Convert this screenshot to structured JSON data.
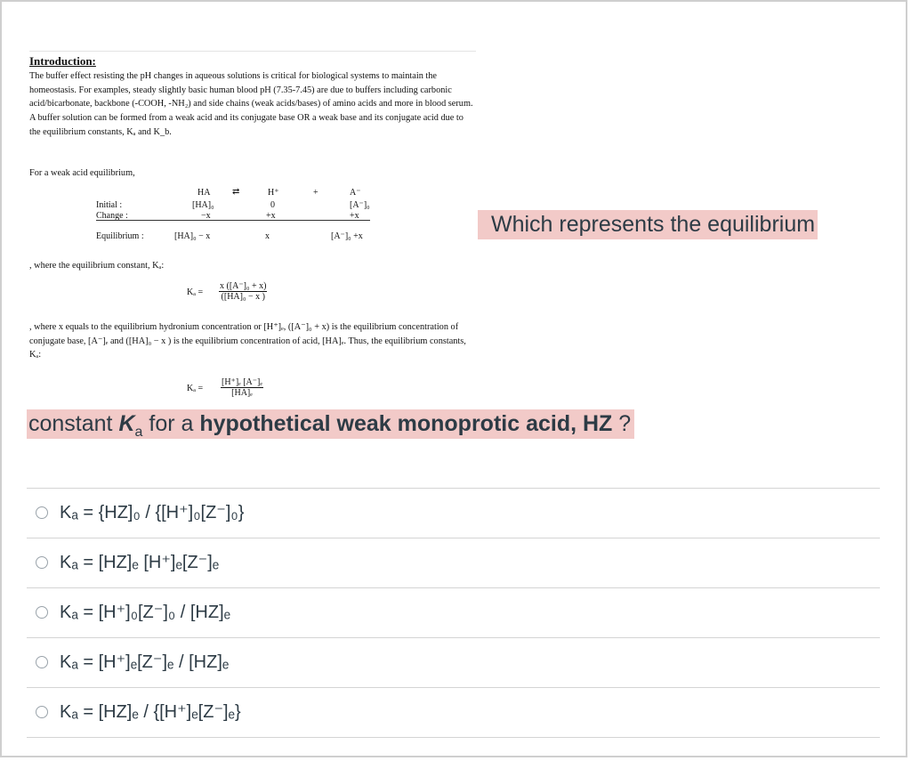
{
  "intro": {
    "title": "Introduction:",
    "paragraph": "The buffer effect resisting the pH changes in aqueous solutions is critical for biological systems to maintain the homeostasis. For examples, steady slightly basic human blood pH (7.35-7.45) are due to buffers including carbonic acid/bicarbonate, backbone (-COOH, -NH₂) and side chains (weak acids/bases) of amino acids and more in blood serum. A buffer solution can be formed from a weak acid and its conjugate base OR a weak base and its conjugate acid due to the equilibrium constants, Kₐ and K_b.",
    "weak_acid_line": "For a weak acid equilibrium,",
    "ice": {
      "species": [
        "HA",
        "⇄",
        "H⁺",
        "+",
        "A⁻"
      ],
      "initial_label": "Initial   :",
      "initial": [
        "[HA]₀",
        "0",
        "[A⁻]₀"
      ],
      "change_label": "Change :",
      "change": [
        "−x",
        "+x",
        "+x"
      ],
      "equilibrium_label": "Equilibrium :",
      "equilibrium": [
        "[HA]₀ − x",
        "x",
        "[A⁻]₀ +x"
      ]
    },
    "where_ka": ", where the equilibrium constant, Kₐ:",
    "ka_expr_1": {
      "lhs": "Kₐ  =",
      "num": "x ([A⁻]₀ + x)",
      "den": "([HA]₀ − x )"
    },
    "where_x": ", where x equals to the equilibrium hydronium concentration or [H⁺]ₑ, ([A⁻]₀ + x) is the equilibrium concentration of conjugate base, [A⁻]ₑ and ([HA]₀ − x ) is the equilibrium concentration of acid, [HA]ₑ. Thus, the equilibrium constants, Kₐ:",
    "ka_expr_2": {
      "lhs": "Kₐ  =",
      "num": "[H⁺]ₑ [A⁻]ₑ",
      "den": "[HA]ₑ"
    }
  },
  "question": {
    "part1": "Which represents the equilibrium",
    "part2_prefix": "constant ",
    "part2_k": "K",
    "part2_sub": "a",
    "part2_mid": " for a ",
    "part2_bold": "hypothetical weak monoprotic acid, HZ",
    "part2_end": " ?",
    "highlight_color": "#f2cac8"
  },
  "answers": [
    {
      "option": "Kₐ = {HZ]₀ / {[H⁺]₀[Z⁻]₀}"
    },
    {
      "option": "Kₐ = [HZ]ₑ [H⁺]ₑ[Z⁻]ₑ"
    },
    {
      "option": "Kₐ = [H⁺]₀[Z⁻]₀ / [HZ]ₑ"
    },
    {
      "option": "Kₐ = [H⁺]ₑ[Z⁻]ₑ / [HZ]ₑ"
    },
    {
      "option": "Kₐ = [HZ]ₑ / {[H⁺]ₑ[Z⁻]ₑ}"
    }
  ]
}
